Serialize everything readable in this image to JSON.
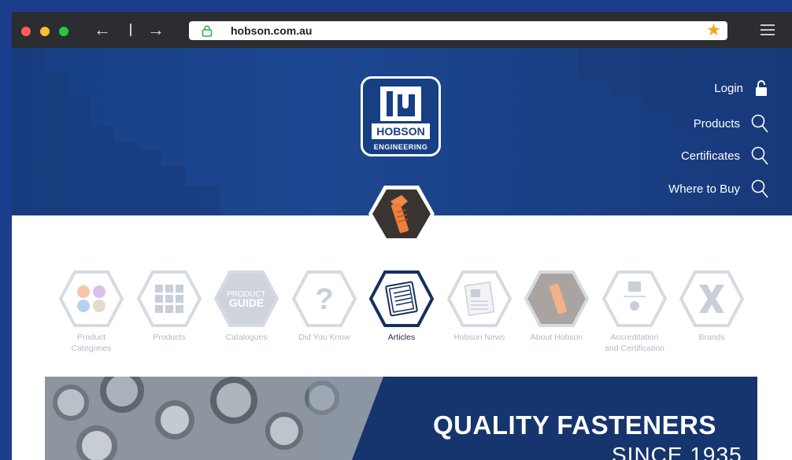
{
  "browser": {
    "url": "hobson.com.au",
    "back_icon": "arrow-left-icon",
    "forward_icon": "arrow-right-icon",
    "lock_icon": "lock-icon",
    "bookmark_icon": "star-icon",
    "menu_icon": "hamburger-icon"
  },
  "logo": {
    "name": "HOBSON",
    "subtitle": "ENGINEERING"
  },
  "header_links": [
    {
      "label": "Login",
      "icon": "unlock-icon"
    },
    {
      "label": "Products",
      "icon": "search-icon"
    },
    {
      "label": "Certificates",
      "icon": "search-icon"
    },
    {
      "label": "Where to Buy",
      "icon": "search-icon"
    }
  ],
  "categories": [
    {
      "line1": "Product",
      "line2": "Categories",
      "icon": "color-dots-icon"
    },
    {
      "line1": "Products",
      "line2": "",
      "icon": "grid-icon"
    },
    {
      "line1": "Catalogues",
      "line2": "",
      "icon": "product-guide-icon",
      "guide_top": "PRODUCT",
      "guide_bottom": "GUIDE"
    },
    {
      "line1": "Did You Know",
      "line2": "",
      "icon": "question-icon"
    },
    {
      "line1": "Articles",
      "line2": "",
      "icon": "newspaper-icon",
      "active": true
    },
    {
      "line1": "Hobson News",
      "line2": "",
      "icon": "news-icon"
    },
    {
      "line1": "About Hobson",
      "line2": "",
      "icon": "bolt-photo-icon"
    },
    {
      "line1": "Accreditation",
      "line2": "and Certification",
      "icon": "certificate-icon"
    },
    {
      "line1": "Brands",
      "line2": "",
      "icon": "brand-x-icon"
    }
  ],
  "banner": {
    "headline": "QUALITY FASTENERS",
    "subline": "SINCE 1935"
  },
  "colors": {
    "brand_blue": "#173f84",
    "accent_orange": "#f28a4a",
    "chrome_dark": "#2b2d31"
  }
}
